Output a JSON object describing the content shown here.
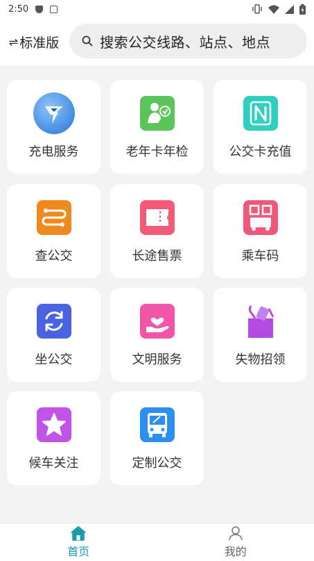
{
  "status_bar": {
    "time": "2:50"
  },
  "header": {
    "mode_label": "标准版",
    "swap_symbol": "⇌",
    "search_placeholder": "搜索公交线路、站点、地点"
  },
  "services": [
    {
      "label": "充电服务",
      "icon": "charging-icon"
    },
    {
      "label": "老年卡年检",
      "icon": "senior-card-icon"
    },
    {
      "label": "公交卡充值",
      "icon": "nfc-icon"
    },
    {
      "label": "查公交",
      "icon": "route-icon"
    },
    {
      "label": "长途售票",
      "icon": "ticket-icon"
    },
    {
      "label": "乘车码",
      "icon": "qr-code-icon"
    },
    {
      "label": "坐公交",
      "icon": "refresh-icon"
    },
    {
      "label": "文明服务",
      "icon": "heart-hand-icon"
    },
    {
      "label": "失物招领",
      "icon": "lost-found-icon"
    },
    {
      "label": "候车关注",
      "icon": "star-icon"
    },
    {
      "label": "定制公交",
      "icon": "bus-icon"
    }
  ],
  "bottom_nav": [
    {
      "label": "首页",
      "icon": "home-icon",
      "active": true
    },
    {
      "label": "我的",
      "icon": "user-icon",
      "active": false
    }
  ],
  "colors": {
    "accent": "#1a9bb0",
    "background": "#f2f3f5"
  }
}
